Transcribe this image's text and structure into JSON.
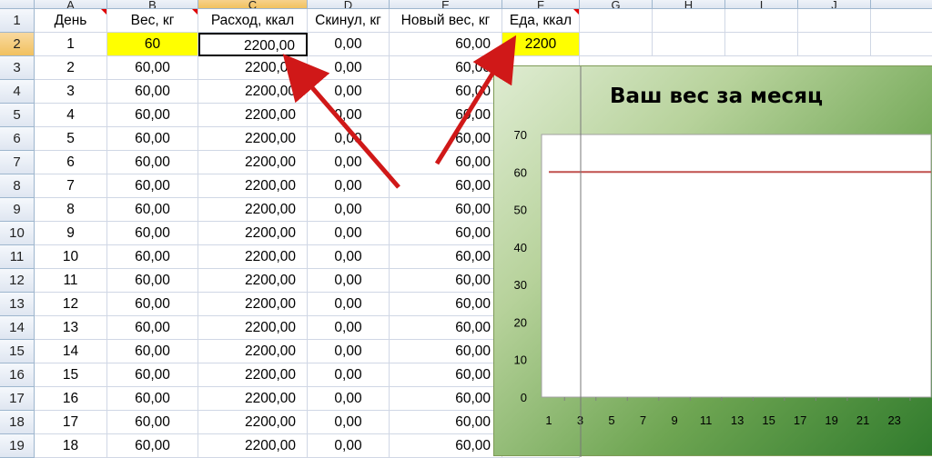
{
  "columns": [
    "A",
    "B",
    "C",
    "D",
    "E",
    "F",
    "G",
    "H",
    "I",
    "J"
  ],
  "headers": [
    "День",
    "Вес, кг",
    "Расход, ккал",
    "Скинул, кг",
    "Новый вес, кг",
    "Еда, ккал"
  ],
  "first_row": {
    "day": "1",
    "weight": "60",
    "expense": "2200,00",
    "lost": "0,00",
    "new_weight": "60,00",
    "food": "2200"
  },
  "rows": [
    {
      "num": "3",
      "day": "2",
      "weight": "60,00",
      "expense": "2200,00",
      "lost": "0,00",
      "new_weight": "60,00"
    },
    {
      "num": "4",
      "day": "3",
      "weight": "60,00",
      "expense": "2200,00",
      "lost": "0,00",
      "new_weight": "60,00"
    },
    {
      "num": "5",
      "day": "4",
      "weight": "60,00",
      "expense": "2200,00",
      "lost": "0,00",
      "new_weight": "60,00"
    },
    {
      "num": "6",
      "day": "5",
      "weight": "60,00",
      "expense": "2200,00",
      "lost": "0,00",
      "new_weight": "60,00"
    },
    {
      "num": "7",
      "day": "6",
      "weight": "60,00",
      "expense": "2200,00",
      "lost": "0,00",
      "new_weight": "60,00"
    },
    {
      "num": "8",
      "day": "7",
      "weight": "60,00",
      "expense": "2200,00",
      "lost": "0,00",
      "new_weight": "60,00"
    },
    {
      "num": "9",
      "day": "8",
      "weight": "60,00",
      "expense": "2200,00",
      "lost": "0,00",
      "new_weight": "60,00"
    },
    {
      "num": "10",
      "day": "9",
      "weight": "60,00",
      "expense": "2200,00",
      "lost": "0,00",
      "new_weight": "60,00"
    },
    {
      "num": "11",
      "day": "10",
      "weight": "60,00",
      "expense": "2200,00",
      "lost": "0,00",
      "new_weight": "60,00"
    },
    {
      "num": "12",
      "day": "11",
      "weight": "60,00",
      "expense": "2200,00",
      "lost": "0,00",
      "new_weight": "60,00"
    },
    {
      "num": "13",
      "day": "12",
      "weight": "60,00",
      "expense": "2200,00",
      "lost": "0,00",
      "new_weight": "60,00"
    },
    {
      "num": "14",
      "day": "13",
      "weight": "60,00",
      "expense": "2200,00",
      "lost": "0,00",
      "new_weight": "60,00"
    },
    {
      "num": "15",
      "day": "14",
      "weight": "60,00",
      "expense": "2200,00",
      "lost": "0,00",
      "new_weight": "60,00"
    },
    {
      "num": "16",
      "day": "15",
      "weight": "60,00",
      "expense": "2200,00",
      "lost": "0,00",
      "new_weight": "60,00"
    },
    {
      "num": "17",
      "day": "16",
      "weight": "60,00",
      "expense": "2200,00",
      "lost": "0,00",
      "new_weight": "60,00"
    },
    {
      "num": "18",
      "day": "17",
      "weight": "60,00",
      "expense": "2200,00",
      "lost": "0,00",
      "new_weight": "60,00"
    },
    {
      "num": "19",
      "day": "18",
      "weight": "60,00",
      "expense": "2200,00",
      "lost": "0,00",
      "new_weight": "60,00"
    }
  ],
  "colors": {
    "input_highlight": "#ffff00",
    "arrow": "#d01818",
    "series_line": "#c0504d"
  },
  "chart_data": {
    "type": "line",
    "title": "Ваш вес за месяц",
    "x": [
      "1",
      "3",
      "5",
      "7",
      "9",
      "11",
      "13",
      "15",
      "17",
      "19",
      "21",
      "23"
    ],
    "yticks": [
      "0",
      "10",
      "20",
      "30",
      "40",
      "50",
      "60",
      "70"
    ],
    "ylim": [
      0,
      70
    ],
    "series": [
      {
        "values": [
          60,
          60,
          60,
          60,
          60,
          60,
          60,
          60,
          60,
          60,
          60,
          60
        ]
      }
    ],
    "grid": false,
    "legend": "none"
  }
}
